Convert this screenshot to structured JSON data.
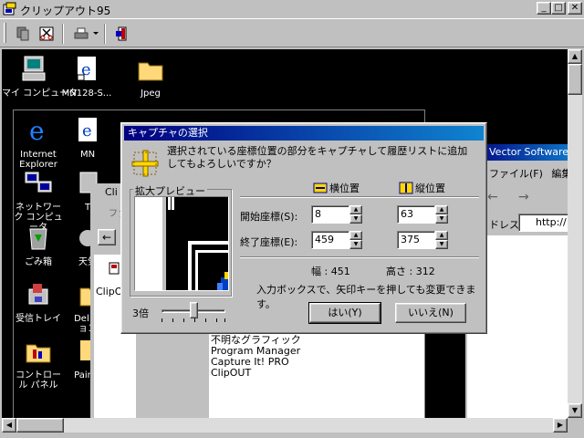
{
  "window": {
    "title": "クリップアウト95"
  },
  "desktop": {
    "icons": [
      {
        "label": "マイ コンピュータ"
      },
      {
        "label": "MN128-S..."
      },
      {
        "label": "Jpeg"
      },
      {
        "label": "Internet Explorer"
      },
      {
        "label": "MN"
      },
      {
        "label": "ネットワーク コンピュータ"
      },
      {
        "label": "T"
      },
      {
        "label": "ごみ箱"
      },
      {
        "label": "天気"
      },
      {
        "label": "受信トレイ"
      },
      {
        "label": "Del ション"
      },
      {
        "label": "コントロール パネル"
      },
      {
        "label": "Pain F"
      }
    ]
  },
  "bg_window": {
    "tab": "Cli",
    "menu_label": "ファ",
    "item": "ClipO",
    "list": [
      "不明なグラフィック",
      "Program Manager",
      "Capture It! PRO",
      "ClipOUT"
    ]
  },
  "browser": {
    "title": "Vector Software",
    "menu": [
      "ファイル(F)",
      "編集"
    ],
    "address_label": "ドレス",
    "address_value": "http://"
  },
  "dialog": {
    "title": "キャプチャの選択",
    "message": "選択されている座標位置の部分をキャプチャして履歴リストに追加してもよろしいですか？",
    "preview_label": "拡大プレビュー",
    "col_x": "横位置",
    "col_y": "縦位置",
    "start_label": "開始座標(S):",
    "end_label": "終了座標(E):",
    "start_x": "8",
    "start_y": "63",
    "end_x": "459",
    "end_y": "375",
    "width_label": "幅 : 451",
    "height_label": "高さ : 312",
    "hint": "入力ボックスで、矢印キーを押しても変更できます。",
    "zoom_label": "3倍",
    "zoom_level": 0.5,
    "yes_button": "はい(Y)",
    "no_button": "いいえ(N)"
  }
}
